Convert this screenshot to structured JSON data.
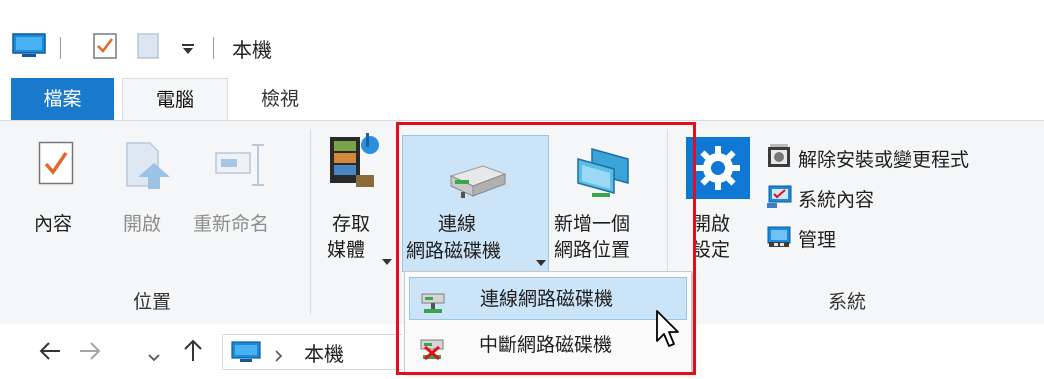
{
  "window": {
    "title": "本機"
  },
  "tabs": [
    {
      "label": "檔案",
      "active": false
    },
    {
      "label": "電腦",
      "active": true
    },
    {
      "label": "檢視",
      "active": false
    }
  ],
  "ribbon": {
    "groups": {
      "location": {
        "label": "位置",
        "buttons": [
          {
            "label": "內容",
            "icon": "properties-checkmark-icon",
            "enabled": true
          },
          {
            "label": "開啟",
            "icon": "open-arrow-icon",
            "enabled": false
          },
          {
            "label": "重新命名",
            "icon": "rename-icon",
            "enabled": false
          }
        ]
      },
      "network": {
        "access_media": {
          "line1": "存取",
          "line2": "媒體",
          "icon": "media-film-icon"
        },
        "map_drive": {
          "line1": "連線",
          "line2": "網路磁碟機",
          "icon": "network-drive-icon"
        },
        "add_location": {
          "line1": "新增一個",
          "line2": "網路位置",
          "icon": "network-location-icon"
        }
      },
      "system": {
        "label": "系統",
        "open_settings": {
          "line1": "開啟",
          "line2": "設定",
          "icon": "gear-icon"
        },
        "items": [
          {
            "label": "解除安裝或變更程式",
            "icon": "uninstall-icon"
          },
          {
            "label": "系統內容",
            "icon": "system-properties-icon"
          },
          {
            "label": "管理",
            "icon": "computer-management-icon"
          }
        ]
      }
    }
  },
  "dropdown": {
    "items": [
      {
        "label": "連線網路磁碟機",
        "icon": "map-drive-icon",
        "highlighted": true
      },
      {
        "label": "中斷網路磁碟機",
        "icon": "disconnect-drive-icon",
        "highlighted": false
      }
    ]
  },
  "address_bar": {
    "path": "本機"
  },
  "colors": {
    "accent": "#1979ca",
    "highlight": "#cce4f7",
    "annotation": "#e0101a"
  }
}
